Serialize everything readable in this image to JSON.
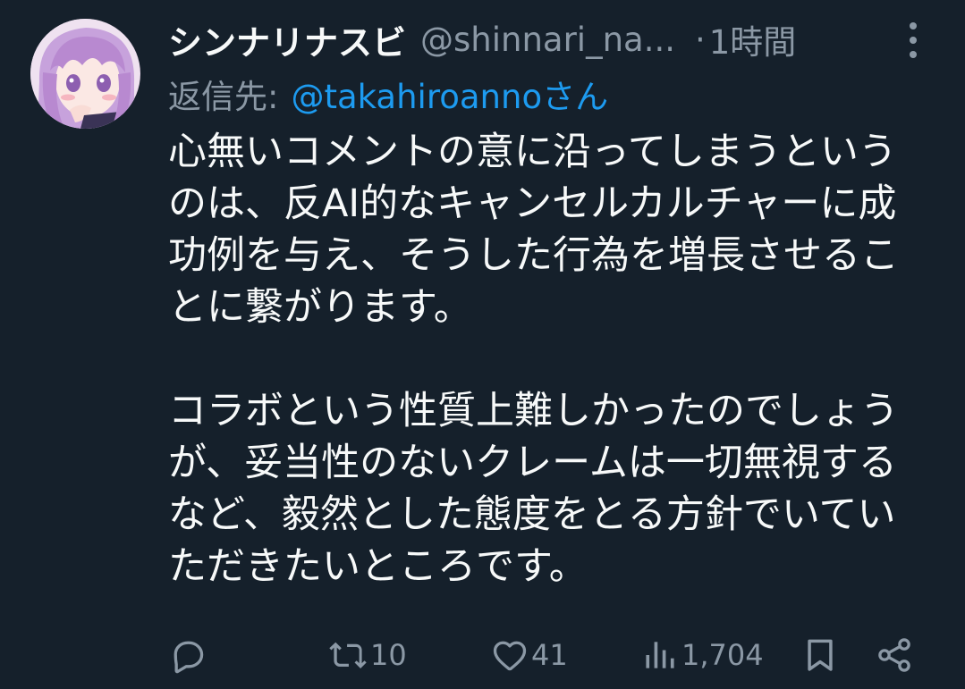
{
  "tweet": {
    "display_name": "シンナリナスビ",
    "handle": "@shinnari_na...",
    "separator": "·",
    "time": "1時間",
    "reply_prefix": "返信先:",
    "reply_mention": "@takahiroannoさん",
    "body_lines": [
      "心無いコメントの意に沿ってしまうという",
      "のは、反AI的なキャンセルカルチャーに成",
      "功例を与え、そうした行為を増長させるこ",
      "とに繋がります。",
      "",
      "コラボという性質上難しかったのでしょう",
      "が、妥当性のないクレームは一切無視する",
      "など、毅然とした態度をとる方針でいてい",
      "ただきたいところです。"
    ]
  },
  "actions": {
    "reply_count": "",
    "retweet_count": "10",
    "like_count": "41",
    "view_count": "1,704"
  },
  "icons": {
    "more": "more-vertical-icon",
    "reply": "reply-icon",
    "retweet": "retweet-icon",
    "like": "heart-icon",
    "views": "views-bar-chart-icon",
    "bookmark": "bookmark-icon",
    "share": "share-icon"
  },
  "colors": {
    "background": "#15202b",
    "text_primary": "#f7f9f9",
    "text_secondary": "#8b98a5",
    "link": "#1d9bf0"
  }
}
